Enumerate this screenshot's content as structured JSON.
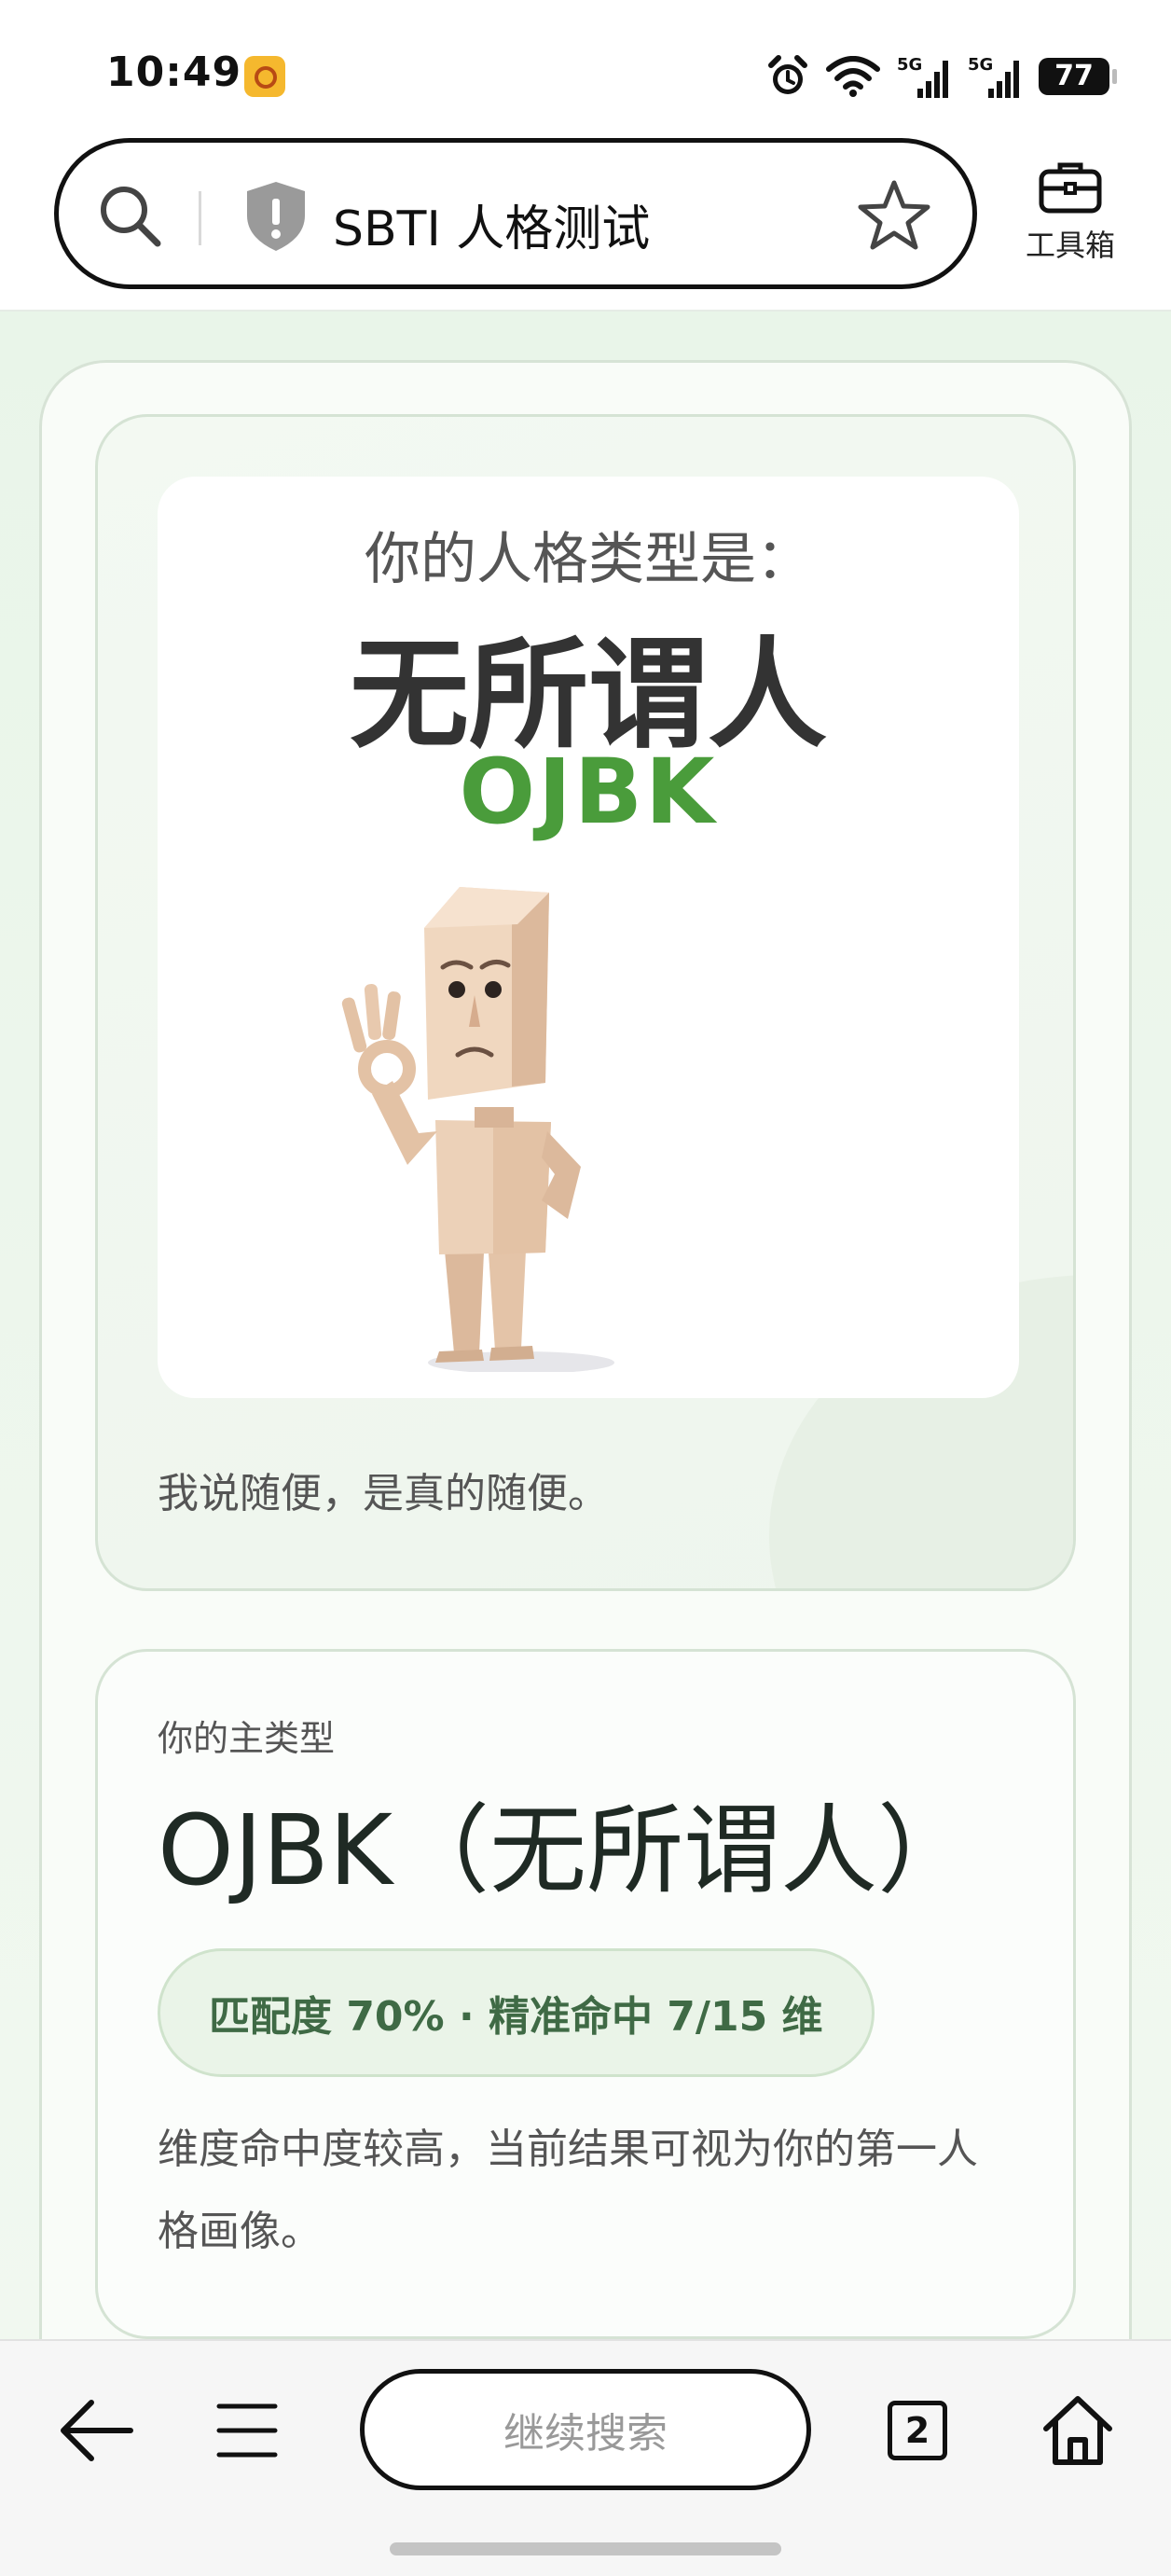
{
  "status_bar": {
    "time": "10:49",
    "battery": "77",
    "network_1": "5G",
    "network_2": "5G"
  },
  "address_bar": {
    "title": "SBTI 人格测试",
    "toolbox_label": "工具箱"
  },
  "result": {
    "subtitle": "你的人格类型是：",
    "type_name": "无所谓人",
    "type_code": "OJBK",
    "caption": "我说随便，是真的随便。"
  },
  "type_card": {
    "label": "你的主类型",
    "title": "OJBK（无所谓人）",
    "match": "匹配度 70% · 精准命中 7/15 维",
    "description": "维度命中度较高，当前结果可视为你的第一人格画像。"
  },
  "bottom_nav": {
    "search_placeholder": "继续搜索",
    "tab_count": "2"
  },
  "colors": {
    "accent_green": "#4a9c3b",
    "page_bg": "#eef7ee",
    "pill_text": "#3f6a45"
  },
  "icons": [
    "search-icon",
    "shield-icon",
    "star-icon",
    "toolbox-icon",
    "alarm-icon",
    "wifi-icon",
    "signal-icon",
    "back-arrow-icon",
    "menu-icon",
    "tabs-icon",
    "home-icon"
  ]
}
